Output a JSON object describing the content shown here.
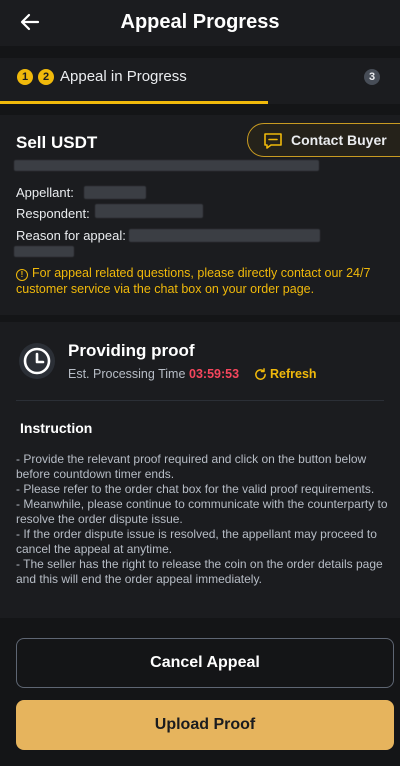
{
  "header": {
    "title": "Appeal Progress",
    "back_icon": "arrow-left-icon"
  },
  "steps": {
    "step1": "1",
    "step2": "2",
    "label": "Appeal in Progress",
    "step3": "3",
    "progress": 0.67
  },
  "order": {
    "title": "Sell USDT",
    "contact_label": "Contact Buyer",
    "appellant_label": "Appellant:",
    "respondent_label": "Respondent:",
    "reason_label": "Reason for appeal:",
    "notice": "For appeal related questions, please directly contact our 24/7 customer service via the chat box on your order page."
  },
  "proof": {
    "title": "Providing proof",
    "est_label": "Est. Processing Time",
    "timer": "03:59:53",
    "refresh_label": "Refresh",
    "instruction_title": "Instruction",
    "instructions": [
      "- Provide the relevant proof required and click on the button below before countdown timer ends.",
      "- Please refer to the order chat box for the valid proof requirements.",
      "- Meanwhile, please continue to communicate with the counterparty to resolve the order dispute issue.",
      "- If the order dispute issue is resolved, the appellant may proceed to cancel the appeal at anytime.",
      "- The seller has the right to release the coin on the order details page and this will end the order appeal immediately."
    ]
  },
  "actions": {
    "cancel_label": "Cancel Appeal",
    "upload_label": "Upload Proof"
  },
  "colors": {
    "accent": "#f0b90b",
    "timer": "#f6465d",
    "upload_button": "#e6b45d",
    "background": "#141517",
    "card": "#1b1c1f"
  }
}
